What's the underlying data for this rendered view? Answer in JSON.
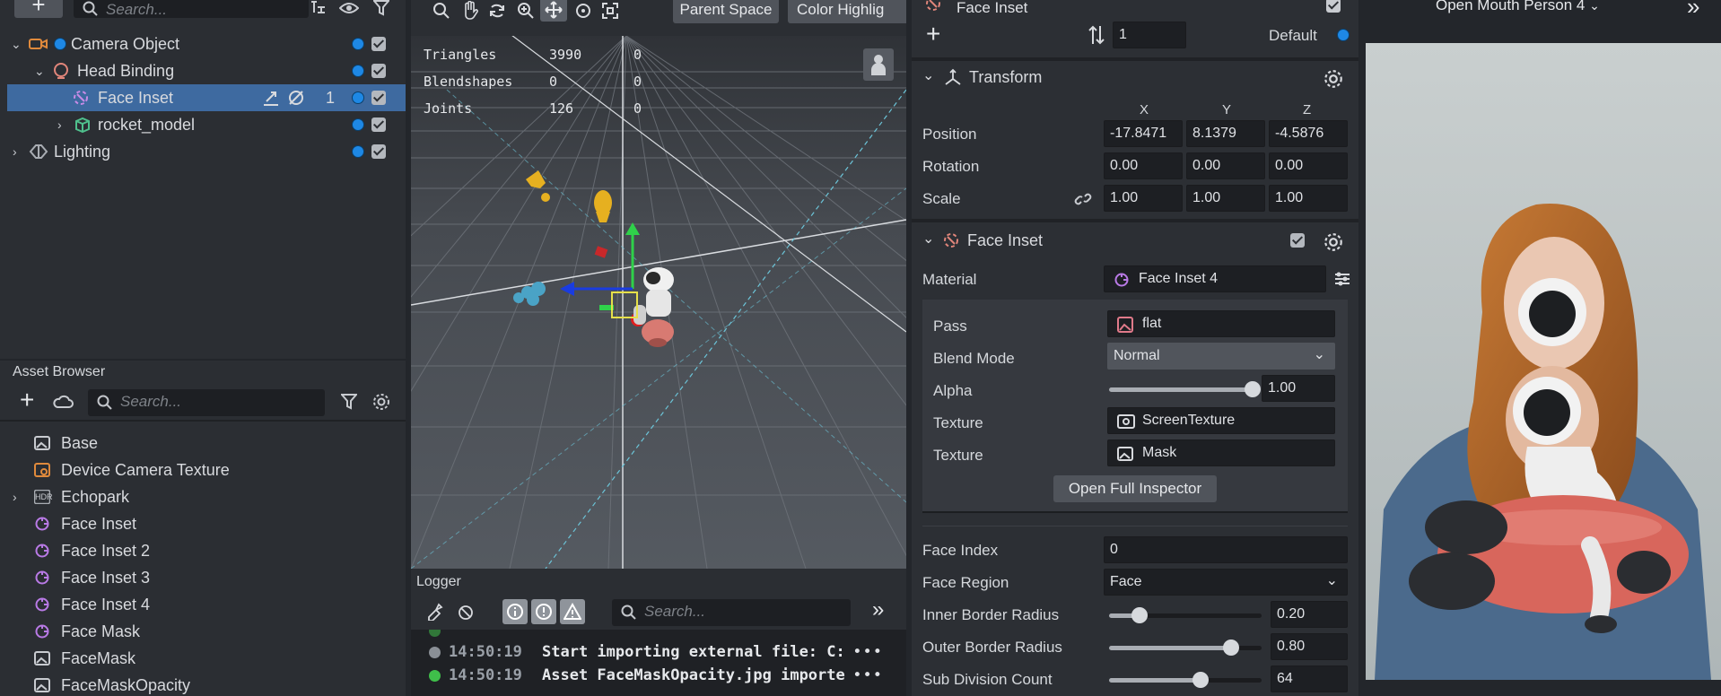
{
  "scene": {
    "search_placeholder": "Search...",
    "items": [
      {
        "label": "Camera Object",
        "icon": "camera-icon"
      },
      {
        "label": "Head Binding",
        "icon": "head-binding-icon"
      },
      {
        "label": "Face Inset",
        "icon": "face-inset-icon",
        "count": "1"
      },
      {
        "label": "rocket_model",
        "icon": "mesh-icon"
      },
      {
        "label": "Lighting",
        "icon": "lighting-icon"
      }
    ]
  },
  "assets": {
    "title": "Asset Browser",
    "search_placeholder": "Search...",
    "items": [
      {
        "label": "Base",
        "icon": "texture-icon"
      },
      {
        "label": "Device Camera Texture",
        "icon": "device-camera-texture-icon"
      },
      {
        "label": "Echopark",
        "icon": "hdr-icon",
        "badge": "HDR"
      },
      {
        "label": "Face Inset",
        "icon": "material-icon"
      },
      {
        "label": "Face Inset 2",
        "icon": "material-icon"
      },
      {
        "label": "Face Inset 3",
        "icon": "material-icon"
      },
      {
        "label": "Face Inset 4",
        "icon": "material-icon"
      },
      {
        "label": "Face Mask",
        "icon": "material-icon"
      },
      {
        "label": "FaceMask",
        "icon": "texture-icon"
      },
      {
        "label": "FaceMaskOpacity",
        "icon": "texture-icon"
      }
    ]
  },
  "viewport": {
    "toolbar": {
      "parent_space": "Parent Space",
      "color_highlight": "Color Highlig"
    },
    "stats": [
      {
        "name": "Triangles",
        "value": "3990",
        "value2": "0"
      },
      {
        "name": "Blendshapes",
        "value": "0",
        "value2": "0"
      },
      {
        "name": "Joints",
        "value": "126",
        "value2": "0"
      }
    ]
  },
  "logger": {
    "title": "Logger",
    "search_placeholder": "Search...",
    "lines": [
      {
        "time": "14:50:19",
        "message": "Start importing external file: C:",
        "status": "gray"
      },
      {
        "time": "14:50:19",
        "message": "Asset FaceMaskOpacity.jpg importe",
        "status": "green"
      }
    ],
    "more": "•••"
  },
  "inspector": {
    "object_name": "Face Inset",
    "layer_value": "1",
    "layer_label": "Default",
    "transform": {
      "title": "Transform",
      "axes": [
        "X",
        "Y",
        "Z"
      ],
      "rows": [
        {
          "label": "Position",
          "values": [
            "-17.8471",
            "8.1379",
            "-4.5876"
          ]
        },
        {
          "label": "Rotation",
          "values": [
            "0.00",
            "0.00",
            "0.00"
          ]
        },
        {
          "label": "Scale",
          "values": [
            "1.00",
            "1.00",
            "1.00"
          ]
        }
      ]
    },
    "face_inset": {
      "title": "Face Inset",
      "material_label": "Material",
      "material_value": "Face Inset 4",
      "pass_label": "Pass",
      "pass_value": "flat",
      "blend_label": "Blend Mode",
      "blend_value": "Normal",
      "alpha_label": "Alpha",
      "alpha_value": "1.00",
      "alpha_fraction": 1.0,
      "texture_label": "Texture",
      "texture1_value": "ScreenTexture",
      "texture2_value": "Mask",
      "open_full": "Open Full Inspector",
      "face_index_label": "Face Index",
      "face_index_value": "0",
      "face_region_label": "Face Region",
      "face_region_value": "Face",
      "inner_label": "Inner Border Radius",
      "inner_value": "0.20",
      "inner_fraction": 0.2,
      "outer_label": "Outer Border Radius",
      "outer_value": "0.80",
      "outer_fraction": 0.8,
      "subdiv_label": "Sub Division Count",
      "subdiv_value": "64",
      "subdiv_fraction": 0.6
    }
  },
  "preview": {
    "lens_name": "Open Mouth Person 4"
  },
  "colors": {
    "selection": "#3e6aa0",
    "accent_blue": "#1e88e5",
    "material_purple": "#b97ae6",
    "camera_orange": "#e08a3c"
  }
}
